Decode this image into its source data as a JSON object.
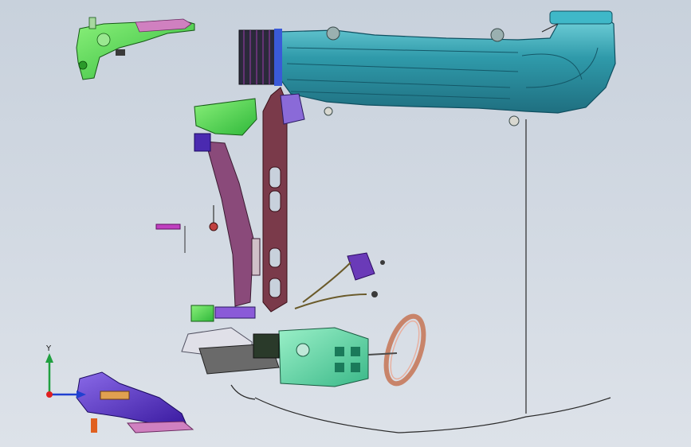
{
  "viewport": {
    "background_top": "#c8d1dc",
    "background_bottom": "#dde2e9"
  },
  "triad": {
    "x_label": "",
    "y_label": "Y",
    "z_label": "",
    "x_color": "#e02020",
    "y_color": "#20a040",
    "z_color": "#2040d0"
  },
  "parts": {
    "air_intake_duct": "#2c8fa0",
    "intake_bellows": "#2a2a3a",
    "frame_rail": "#7a3a4a",
    "shift_linkage_arm": "#8a4a7a",
    "mount_bracket_green": "#4ad84a",
    "bracket_purple": "#6a3ab8",
    "gearbox_housing": "#5ad8a0",
    "steering_wheel_rim": "#c8846a",
    "cable_harness": "#2a2a2a"
  }
}
